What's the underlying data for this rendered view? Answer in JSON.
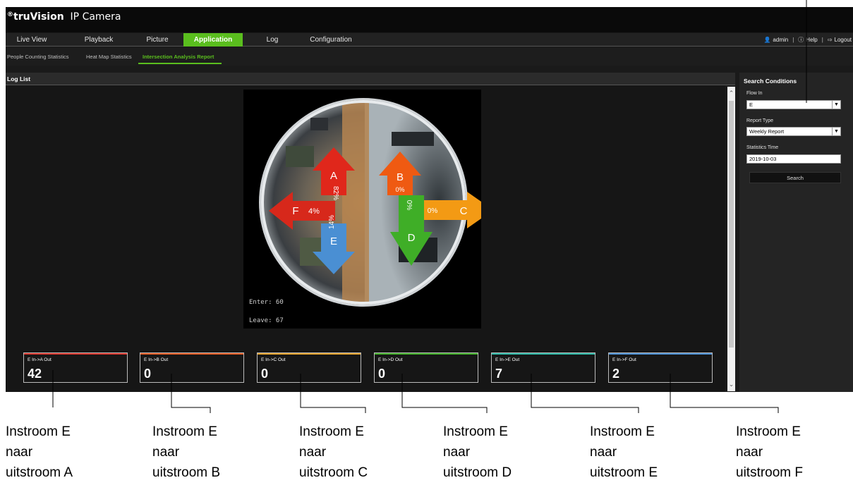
{
  "app": {
    "brand": "truVision",
    "brand_sub": "IP Camera",
    "brand_mark": "®",
    "nav": [
      "Live View",
      "Playback",
      "Picture",
      "Application",
      "Log",
      "Configuration"
    ],
    "active_nav": "Application",
    "user": {
      "name": "admin",
      "help": "Help",
      "logout": "Logout"
    },
    "subnav": [
      "People Counting Statistics",
      "Heat Map Statistics",
      "Intersection Analysis Report"
    ],
    "active_subnav": "Intersection Analysis Report",
    "log_list_title": "Log List"
  },
  "camera": {
    "enter_text": "Enter: 60",
    "leave_text": "Leave: 67",
    "arrows": [
      {
        "letter": "A",
        "pct": "82%",
        "color": "#e0271b"
      },
      {
        "letter": "B",
        "pct": "0%",
        "color": "#ef5a12"
      },
      {
        "letter": "C",
        "pct": "0%",
        "color": "#f39a14"
      },
      {
        "letter": "D",
        "pct": "0%",
        "color": "#3fae27"
      },
      {
        "letter": "E",
        "pct": "14%",
        "color": "#4a8fd3"
      },
      {
        "letter": "F",
        "pct": "4%",
        "color": "#d7281b"
      }
    ]
  },
  "search": {
    "title": "Search Conditions",
    "flow_in_label": "Flow In",
    "flow_in_value": "E",
    "report_type_label": "Report Type",
    "report_type_value": "Weekly Report",
    "statistics_time_label": "Statistics Time",
    "statistics_time_value": "2019-10-03",
    "search_button": "Search"
  },
  "counters": [
    {
      "label": "E In->A Out",
      "value": "42",
      "color": "#d9342b"
    },
    {
      "label": "E In->B Out",
      "value": "0",
      "color": "#e35a22"
    },
    {
      "label": "E In->C Out",
      "value": "0",
      "color": "#e3a12c"
    },
    {
      "label": "E In->D Out",
      "value": "0",
      "color": "#3fae27"
    },
    {
      "label": "E In->E Out",
      "value": "7",
      "color": "#2bb7a6"
    },
    {
      "label": "E In->F Out",
      "value": "2",
      "color": "#4a8fd3"
    }
  ],
  "callouts": [
    [
      "Instroom E",
      "naar",
      "uitstroom A"
    ],
    [
      "Instroom E",
      "naar",
      "uitstroom B"
    ],
    [
      "Instroom E",
      "naar",
      "uitstroom C"
    ],
    [
      "Instroom E",
      "naar",
      "uitstroom D"
    ],
    [
      "Instroom E",
      "naar",
      "uitstroom E"
    ],
    [
      "Instroom E",
      "naar",
      "uitstroom F"
    ]
  ]
}
